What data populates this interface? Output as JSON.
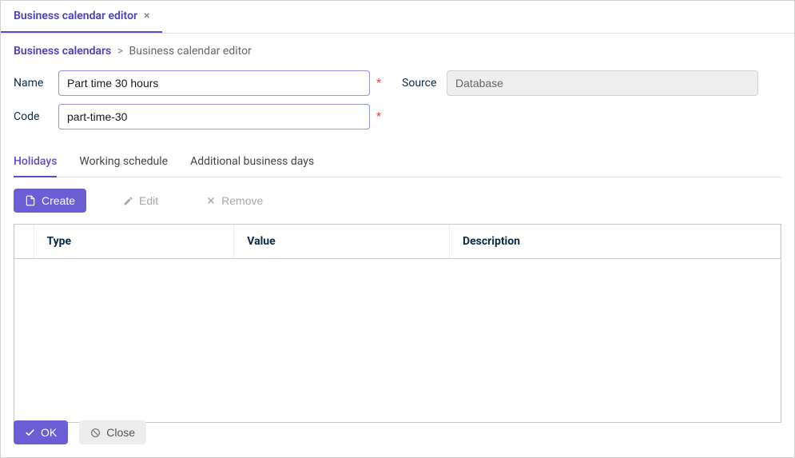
{
  "tab": {
    "title": "Business calendar editor"
  },
  "breadcrumb": {
    "root": "Business calendars",
    "current": "Business calendar editor"
  },
  "form": {
    "name_label": "Name",
    "name_value": "Part time 30 hours",
    "code_label": "Code",
    "code_value": "part-time-30",
    "source_label": "Source",
    "source_value": "Database"
  },
  "subtabs": {
    "holidays": "Holidays",
    "schedule": "Working schedule",
    "additional": "Additional business days"
  },
  "toolbar": {
    "create": "Create",
    "edit": "Edit",
    "remove": "Remove"
  },
  "table": {
    "col_type": "Type",
    "col_value": "Value",
    "col_desc": "Description"
  },
  "footer": {
    "ok": "OK",
    "close": "Close"
  }
}
